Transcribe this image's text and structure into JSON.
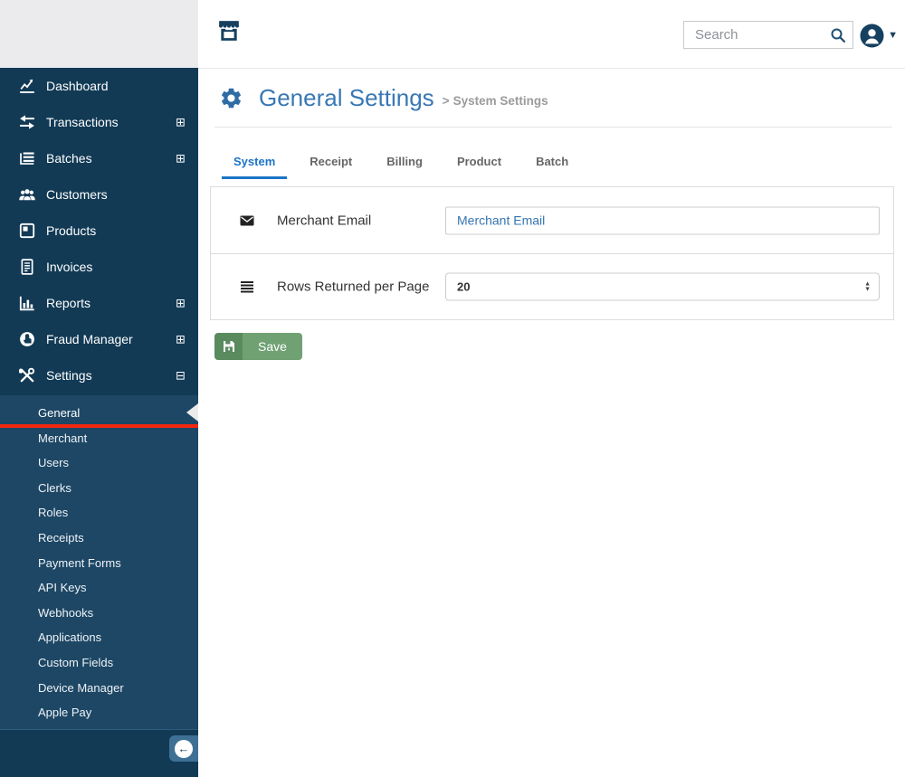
{
  "header": {
    "search": {
      "placeholder": "Search"
    }
  },
  "sidebar": {
    "items": [
      {
        "label": "Dashboard",
        "icon": "chart-line-icon",
        "expand": ""
      },
      {
        "label": "Transactions",
        "icon": "swap-arrows-icon",
        "expand": "⊞"
      },
      {
        "label": "Batches",
        "icon": "batch-list-icon",
        "expand": "⊞"
      },
      {
        "label": "Customers",
        "icon": "users-icon",
        "expand": ""
      },
      {
        "label": "Products",
        "icon": "box-icon",
        "expand": ""
      },
      {
        "label": "Invoices",
        "icon": "invoice-icon",
        "expand": ""
      },
      {
        "label": "Reports",
        "icon": "bar-chart-icon",
        "expand": "⊞"
      },
      {
        "label": "Fraud Manager",
        "icon": "hand-stop-icon",
        "expand": "⊞"
      },
      {
        "label": "Settings",
        "icon": "tools-icon",
        "expand": "⊟"
      }
    ],
    "submenu": {
      "items": [
        "General",
        "Merchant",
        "Users",
        "Clerks",
        "Roles",
        "Receipts",
        "Payment Forms",
        "API Keys",
        "Webhooks",
        "Applications",
        "Custom Fields",
        "Device Manager",
        "Apple Pay"
      ],
      "active": "General"
    }
  },
  "page": {
    "title": "General Settings",
    "breadcrumb_sep": ">",
    "breadcrumb": "System Settings"
  },
  "tabs": [
    {
      "label": "System",
      "active": true
    },
    {
      "label": "Receipt",
      "active": false
    },
    {
      "label": "Billing",
      "active": false
    },
    {
      "label": "Product",
      "active": false
    },
    {
      "label": "Batch",
      "active": false
    }
  ],
  "form": {
    "rows": [
      {
        "icon": "envelope-icon",
        "label": "Merchant Email",
        "control": "input",
        "value": "",
        "placeholder": "Merchant Email"
      },
      {
        "icon": "rows-icon",
        "label": "Rows Returned per Page",
        "control": "select",
        "value": "20"
      }
    ],
    "save_label": "Save"
  },
  "icons": {
    "expand": "⊞",
    "collapse": "⊟",
    "caret_down": "▼",
    "stepper_up": "▲",
    "stepper_down": "▼",
    "back_arrow": "←"
  },
  "colors": {
    "sidebar_bg": "#123a55",
    "submenu_bg": "#1d4765",
    "active_marker_red": "#f4260e",
    "accent_blue": "#3878b4",
    "tab_active_blue": "#1b74c7",
    "save_green": "#6fa173",
    "save_green_dark": "#5a8b5e",
    "navy_icon": "#16405f"
  }
}
